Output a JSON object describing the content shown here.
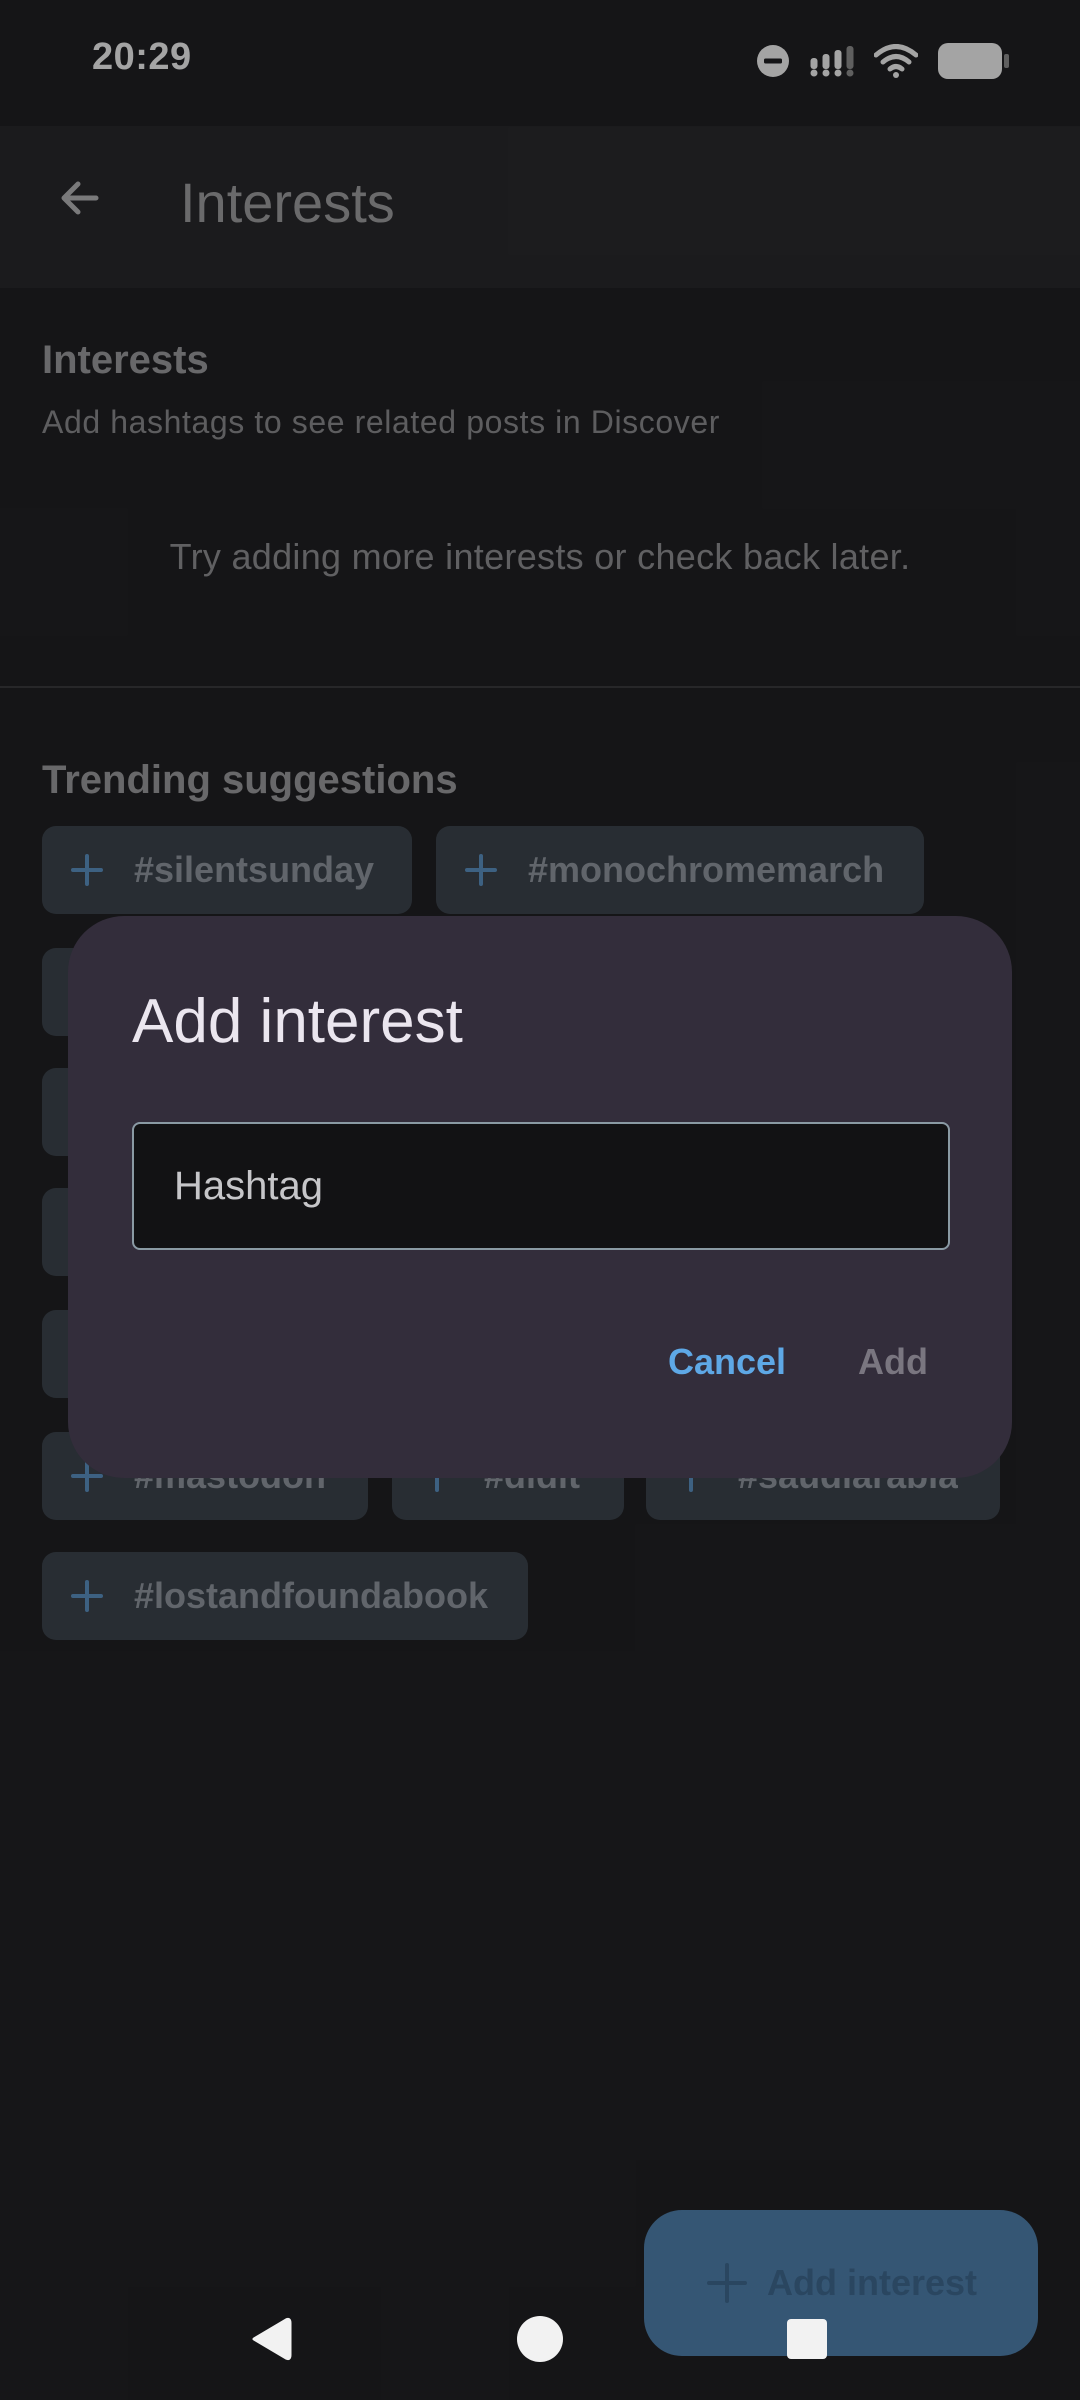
{
  "status_bar": {
    "time": "20:29",
    "icons": [
      "do-not-disturb-icon",
      "signal-icon",
      "wifi-icon",
      "battery-icon"
    ]
  },
  "app_bar": {
    "back_icon": "arrow-back-icon",
    "title": "Interests"
  },
  "interests": {
    "title": "Interests",
    "subtitle": "Add hashtags to see related posts in Discover",
    "empty_message": "Try adding more interests or check back later."
  },
  "trending": {
    "title": "Trending suggestions",
    "chips": [
      {
        "label": "#silentsunday"
      },
      {
        "label": "#monochromemarch"
      },
      {
        "label": "#mastodon"
      },
      {
        "label": "#didit"
      },
      {
        "label": "#saudiarabia"
      },
      {
        "label": "#lostandfoundabook"
      }
    ],
    "hidden_chip_count": 4
  },
  "fab": {
    "label": "Add interest",
    "icon": "plus-icon"
  },
  "nav_bar": {
    "icons": [
      "nav-back-icon",
      "nav-home-icon",
      "nav-recents-icon"
    ]
  },
  "dialog": {
    "title": "Add interest",
    "input_placeholder": "Hashtag",
    "input_value": "",
    "cancel_label": "Cancel",
    "add_label": "Add"
  },
  "colors": {
    "background": "#202023",
    "app_bar": "#29292c",
    "chip_bg": "#3b434c",
    "dialog_bg": "#332d3b",
    "accent": "#5ea8e6",
    "fab_bg": "#4e7fac"
  }
}
